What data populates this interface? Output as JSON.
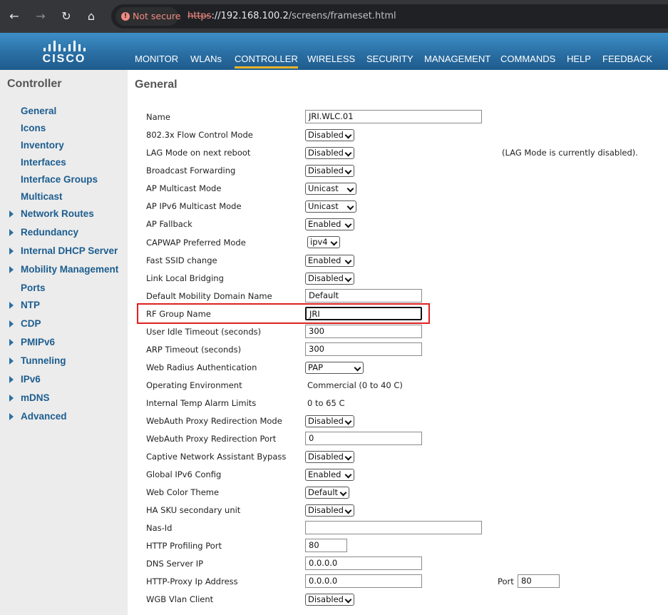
{
  "browser": {
    "not_secure": "Not secure",
    "url_proto": "https",
    "url_host": "://192.168.100.2",
    "url_path": "/screens/frameset.html"
  },
  "brand": {
    "logo_text": "CISCO"
  },
  "topnav": [
    "MONITOR",
    "WLANs",
    "CONTROLLER",
    "WIRELESS",
    "SECURITY",
    "MANAGEMENT",
    "COMMANDS",
    "HELP",
    "FEEDBACK"
  ],
  "sidebar": {
    "title": "Controller",
    "items": [
      {
        "label": "General"
      },
      {
        "label": "Icons"
      },
      {
        "label": "Inventory"
      },
      {
        "label": "Interfaces"
      },
      {
        "label": "Interface Groups"
      },
      {
        "label": "Multicast"
      },
      {
        "label": "Network Routes"
      },
      {
        "label": "Redundancy"
      },
      {
        "label": "Internal DHCP Server"
      },
      {
        "label": "Mobility Management"
      },
      {
        "label": "Ports"
      },
      {
        "label": "NTP"
      },
      {
        "label": "CDP"
      },
      {
        "label": "PMIPv6"
      },
      {
        "label": "Tunneling"
      },
      {
        "label": "IPv6"
      },
      {
        "label": "mDNS"
      },
      {
        "label": "Advanced"
      }
    ]
  },
  "main": {
    "title": "General",
    "lag_note": "(LAG Mode is currently disabled).",
    "port_label": "Port",
    "rows": [
      {
        "label": "Name",
        "value": "JRI.WLC.01"
      },
      {
        "label": "802.3x Flow Control Mode",
        "value": "Disabled"
      },
      {
        "label": "LAG Mode on next reboot",
        "value": "Disabled"
      },
      {
        "label": "Broadcast Forwarding",
        "value": "Disabled"
      },
      {
        "label": "AP Multicast Mode",
        "value": "Unicast"
      },
      {
        "label": "AP IPv6 Multicast Mode",
        "value": "Unicast"
      },
      {
        "label": "AP Fallback",
        "value": "Enabled"
      },
      {
        "label": "CAPWAP Preferred Mode",
        "value": "ipv4"
      },
      {
        "label": "Fast SSID change",
        "value": "Enabled"
      },
      {
        "label": "Link Local Bridging",
        "value": "Disabled"
      },
      {
        "label": "Default Mobility Domain Name",
        "value": "Default"
      },
      {
        "label": "RF Group Name",
        "value": "JRI"
      },
      {
        "label": "User Idle Timeout (seconds)",
        "value": "300"
      },
      {
        "label": "ARP Timeout (seconds)",
        "value": "300"
      },
      {
        "label": "Web Radius Authentication",
        "value": "PAP"
      },
      {
        "label": "Operating Environment",
        "value": "Commercial (0 to 40 C)"
      },
      {
        "label": "Internal Temp Alarm Limits",
        "value": "0 to 65 C"
      },
      {
        "label": "WebAuth Proxy Redirection Mode",
        "value": "Disabled"
      },
      {
        "label": "WebAuth Proxy Redirection Port",
        "value": "0"
      },
      {
        "label": "Captive Network Assistant Bypass",
        "value": "Disabled"
      },
      {
        "label": "Global IPv6 Config",
        "value": "Enabled"
      },
      {
        "label": "Web Color Theme",
        "value": "Default"
      },
      {
        "label": "HA SKU secondary unit",
        "value": "Disabled"
      },
      {
        "label": "Nas-Id",
        "value": ""
      },
      {
        "label": "HTTP Profiling Port",
        "value": "80"
      },
      {
        "label": "DNS Server IP",
        "value": "0.0.0.0"
      },
      {
        "label": "HTTP-Proxy Ip Address",
        "value": "0.0.0.0",
        "port": "80"
      },
      {
        "label": "WGB Vlan Client",
        "value": "Disabled"
      }
    ]
  }
}
